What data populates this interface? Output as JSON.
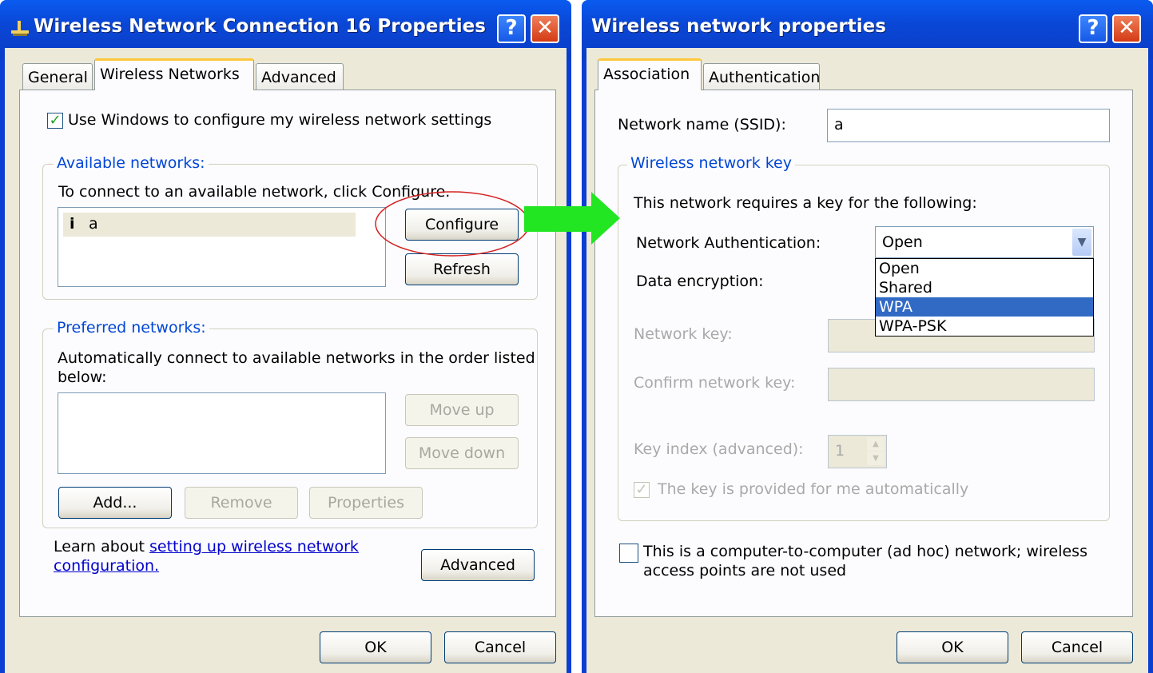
{
  "left": {
    "title": "Wireless Network Connection 16 Properties",
    "tabs": [
      "General",
      "Wireless Networks",
      "Advanced"
    ],
    "use_windows_label": "Use Windows to configure my wireless network settings",
    "available": {
      "legend": "Available networks:",
      "instruction": "To connect to an available network, click Configure.",
      "networks": [
        "a"
      ],
      "configure_label": "Configure",
      "refresh_label": "Refresh"
    },
    "preferred": {
      "legend": "Preferred networks:",
      "instruction_line1": "Automatically connect to available networks in the order listed",
      "instruction_line2": "below:",
      "move_up_label": "Move up",
      "move_down_label": "Move down",
      "add_label": "Add...",
      "remove_label": "Remove",
      "properties_label": "Properties"
    },
    "learn_prefix": "Learn about ",
    "learn_link_line1": "setting up wireless network",
    "learn_link_line2": "configuration.",
    "advanced_label": "Advanced",
    "ok_label": "OK",
    "cancel_label": "Cancel"
  },
  "right": {
    "title": "Wireless network properties",
    "tabs": [
      "Association",
      "Authentication"
    ],
    "ssid_label": "Network name (SSID):",
    "ssid_value": "a",
    "key_group": {
      "legend": "Wireless network key",
      "requires_text": "This network requires a key for the following:",
      "auth_label": "Network Authentication:",
      "auth_selected": "Open",
      "auth_options": [
        "Open",
        "Shared",
        "WPA",
        "WPA-PSK"
      ],
      "auth_highlighted": "WPA",
      "encryption_label": "Data encryption:",
      "network_key_label": "Network key:",
      "confirm_key_label": "Confirm network key:",
      "key_index_label": "Key index (advanced):",
      "key_index_value": "1",
      "auto_key_label": "The key is provided for me automatically"
    },
    "adhoc_line1": "This is a computer-to-computer (ad hoc) network; wireless",
    "adhoc_line2": "access points are not used",
    "ok_label": "OK",
    "cancel_label": "Cancel"
  },
  "colors": {
    "titlebar": "#0a47d6",
    "dialog_bg": "#ece9d8",
    "highlight": "#316ac5",
    "arrow": "#22e622",
    "annotation_ellipse": "#d42020"
  }
}
